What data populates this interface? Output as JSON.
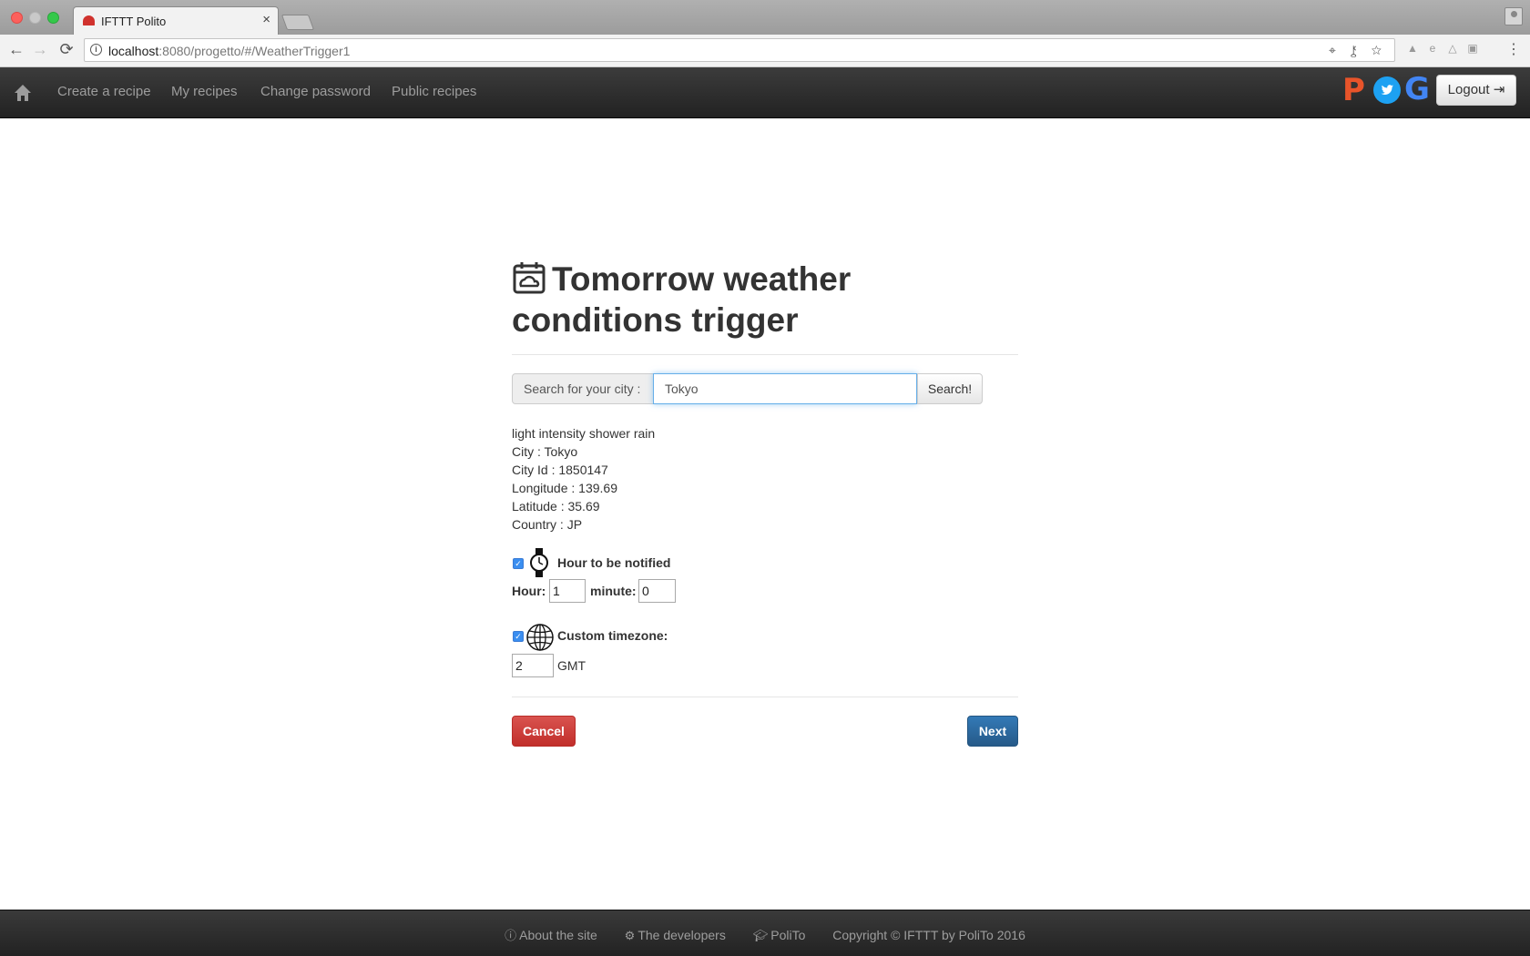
{
  "browser": {
    "tab_title": "IFTTT Polito",
    "tab_close": "×",
    "url_host": "localhost",
    "url_rest": ":8080/progetto/#/WeatherTrigger1",
    "back_glyph": "←",
    "forward_glyph": "→",
    "reload_glyph": "⟳",
    "info_glyph": "i",
    "menu_glyph": "⋮",
    "omnibox_icons": "⌖ ⚷ ☆"
  },
  "navbar": {
    "home_icon": "home-icon",
    "links": [
      "Create a recipe",
      "My recipes",
      "Change password",
      "Public recipes"
    ],
    "brand_p": "P",
    "brand_g": "G",
    "logout_label": "Logout"
  },
  "page": {
    "title": "Tomorrow weather conditions trigger",
    "search_label": "Search for your city :",
    "search_value": "Tokyo",
    "search_button": "Search!",
    "weather": {
      "description": "light intensity shower rain",
      "city": "City : Tokyo",
      "city_id": "City Id : 1850147",
      "longitude": "Longitude : 139.69",
      "latitude": "Latitude : 35.69",
      "country": "Country : JP"
    },
    "hour_section_label": "Hour to be notified",
    "hour_label": "Hour:",
    "hour_value": "1",
    "minute_label": "minute:",
    "minute_value": "0",
    "timezone_label": "Custom timezone:",
    "timezone_value": "2",
    "gmt_label": "GMT",
    "cancel_label": "Cancel",
    "next_label": "Next",
    "hour_checked": true,
    "timezone_checked": true
  },
  "footer": {
    "about": "About the site",
    "developers": "The developers",
    "polito": "PoliTo",
    "copyright": "Copyright © IFTTT by PoliTo 2016"
  },
  "colors": {
    "cancel": "#d9534f",
    "next": "#337ab7",
    "navbar": "#222222",
    "twitter": "#1da1f2",
    "brand_p": "#e8542a"
  }
}
